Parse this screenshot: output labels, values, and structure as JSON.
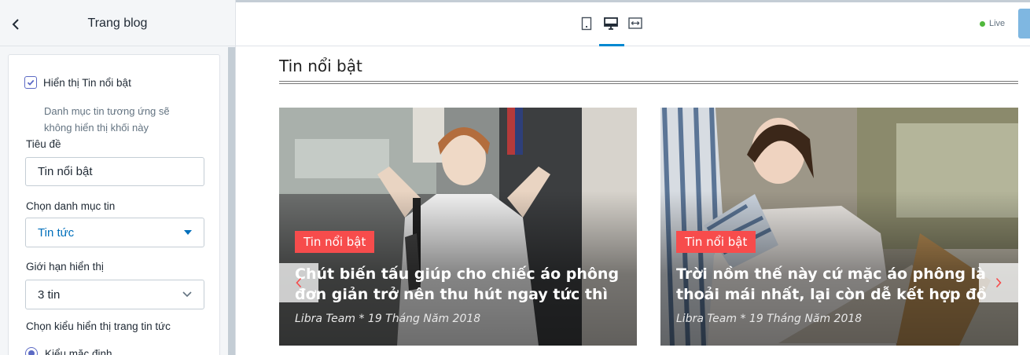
{
  "sidebar": {
    "title": "Trang blog",
    "show_featured": {
      "label": "Hiển thị Tin nổi bật",
      "checked": true,
      "help": "Danh mục tin tương ứng sẽ không hiển thị khối này"
    },
    "title_field": {
      "label": "Tiêu đề",
      "value": "Tin nổi bật"
    },
    "category_field": {
      "label": "Chọn danh mục tin",
      "value": "Tin tức"
    },
    "limit_field": {
      "label": "Giới hạn hiển thị",
      "value": "3 tin"
    },
    "display_style": {
      "label": "Chọn kiểu hiển thị trang tin tức",
      "option": "Kiểu mặc định"
    }
  },
  "topbar": {
    "devices": [
      "mobile-icon",
      "desktop-icon",
      "fullwidth-icon"
    ],
    "active_device": "desktop",
    "live_label": "Live"
  },
  "preview": {
    "section_title": "Tin nổi bật",
    "posts": [
      {
        "tag": "Tin nổi bật",
        "title": "Chút biến tấu giúp cho chiếc áo phông đơn giản trở nên thu hút ngay tức thì",
        "meta": "Libra Team *  19 Tháng Năm 2018"
      },
      {
        "tag": "Tin nổi bật",
        "title": "Trời nồm thế này cứ mặc áo phông là thoải mái nhất, lại còn dễ kết hợp đồ",
        "meta": "Libra Team *  19 Tháng Năm 2018"
      }
    ]
  },
  "colors": {
    "accent": "#5c6ac4",
    "tag": "#f74c4c",
    "live": "#50b83c",
    "active_device": "#0088d1",
    "select_text": "#006fbb"
  }
}
